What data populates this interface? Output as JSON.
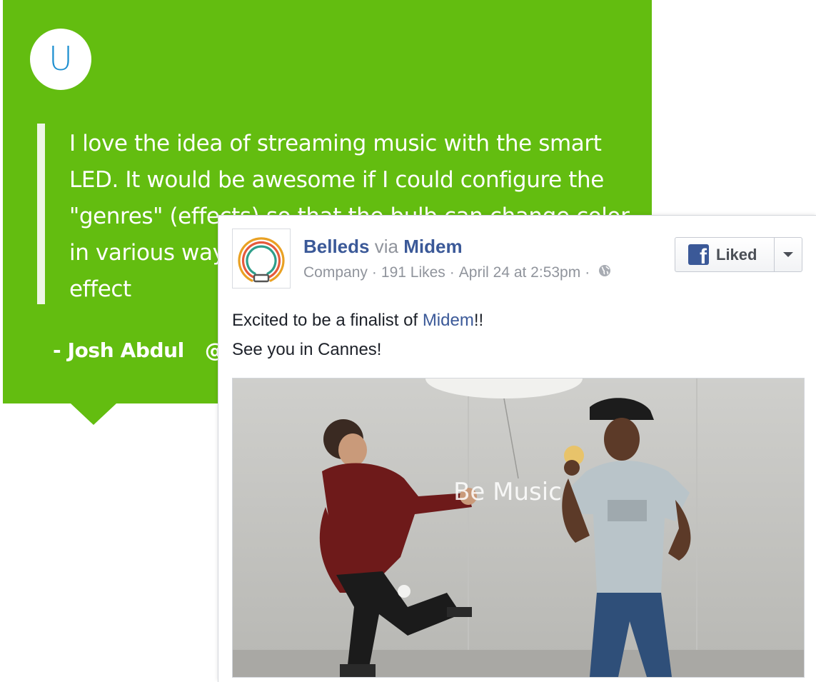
{
  "testimonial": {
    "avatar_letter": "U",
    "quote": "I love the idea of streaming music with the smart LED. It would be awesome if I could configure the \"genres\" (effects) so that the bulb can change color in various ways. I'd love to see more ways to output effect",
    "author": "- Josh Abdul",
    "handle_fragment": "@",
    "colors": {
      "background": "#63bd10",
      "avatar_letter": "#1d8fd0"
    }
  },
  "post": {
    "page_name": "Belleds",
    "via_label": "via",
    "via_page": "Midem",
    "category": "Company",
    "likes": "191 Likes",
    "date": "April 24 at 2:53pm",
    "like_button_label": "Liked",
    "text_prefix": "Excited to be a finalist of ",
    "text_link": "Midem",
    "text_suffix": "!!",
    "text_line2": "See you in Cannes!",
    "image_overlay_text": "Be Music",
    "colors": {
      "link": "#3b5998",
      "meta": "#90949c",
      "text": "#1d2129"
    }
  }
}
